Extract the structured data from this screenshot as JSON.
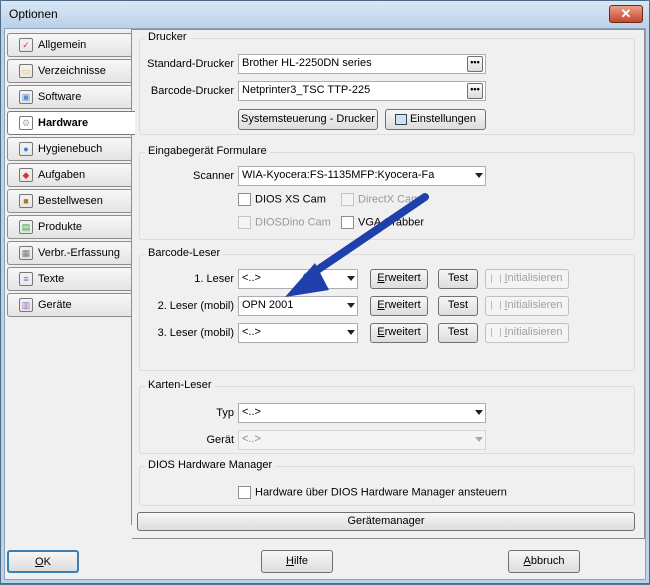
{
  "window": {
    "title": "Optionen",
    "close_glyph": "✕"
  },
  "tabs": [
    {
      "label": "Allgemein",
      "icon": "checklist-icon",
      "glyph": "✓",
      "color": "#d33"
    },
    {
      "label": "Verzeichnisse",
      "icon": "folder-icon",
      "glyph": "▭",
      "color": "#e8c04a"
    },
    {
      "label": "Software",
      "icon": "software-box-icon",
      "glyph": "▣",
      "color": "#5a8fd6"
    },
    {
      "label": "Hardware",
      "icon": "gear-icon",
      "glyph": "⚙",
      "color": "#aaa"
    },
    {
      "label": "Hygienebuch",
      "icon": "lightbulb-icon",
      "glyph": "●",
      "color": "#3a7fd0"
    },
    {
      "label": "Aufgaben",
      "icon": "tasks-icon",
      "glyph": "◆",
      "color": "#d33"
    },
    {
      "label": "Bestellwesen",
      "icon": "order-icon",
      "glyph": "■",
      "color": "#b07a1a"
    },
    {
      "label": "Produkte",
      "icon": "products-icon",
      "glyph": "▤",
      "color": "#2e9e3e"
    },
    {
      "label": "Verbr.-Erfassung",
      "icon": "capture-icon",
      "glyph": "▦",
      "color": "#777"
    },
    {
      "label": "Texte",
      "icon": "document-icon",
      "glyph": "≡",
      "color": "#4a7fc0"
    },
    {
      "label": "Geräte",
      "icon": "devices-icon",
      "glyph": "▥",
      "color": "#9a6cc0"
    }
  ],
  "drucker": {
    "title": "Drucker",
    "standard_label": "Standard-Drucker",
    "standard_value": "Brother HL-2250DN series",
    "barcode_label": "Barcode-Drucker",
    "barcode_value": "Netprinter3_TSC TTP-225",
    "browse_glyph": "•••",
    "systemsteuerung_button": "Systemsteuerung - Drucker",
    "einstellungen_button": "Einstellungen"
  },
  "eingabe": {
    "title": "Eingabegerät Formulare",
    "scanner_label": "Scanner",
    "scanner_value": "WIA-Kyocera:FS-1135MFP:Kyocera-Fa",
    "cb_dios_xs": "DIOS XS Cam",
    "cb_directx": "DirectX Cam",
    "cb_diosdino": "DIOSDino Cam",
    "cb_vga": "VGA Grabber"
  },
  "barcode_leser": {
    "title": "Barcode-Leser",
    "rows": [
      {
        "label": "1. Leser",
        "value": "<..>"
      },
      {
        "label": "2. Leser (mobil)",
        "value": "OPN 2001"
      },
      {
        "label": "3. Leser (mobil)",
        "value": "<..>"
      }
    ],
    "erweitert_first": "E",
    "erweitert_rest": "rweitert",
    "test": "Test",
    "initialisieren_first": "I",
    "initialisieren_rest": "nitialisieren"
  },
  "karten_leser": {
    "title": "Karten-Leser",
    "typ_label": "Typ",
    "typ_value": "<..>",
    "geraet_label": "Gerät",
    "geraet_value": "<..>"
  },
  "dios_manager": {
    "title": "DIOS Hardware Manager",
    "checkbox_label": "Hardware über DIOS Hardware Manager ansteuern"
  },
  "geraetemanager_button": "Gerätemanager",
  "footer": {
    "ok_first": "O",
    "ok_rest": "K",
    "hilfe_first": "H",
    "hilfe_rest": "ilfe",
    "abbruch_first": "A",
    "abbruch_rest": "bbruch"
  },
  "colors": {
    "annotation_arrow": "#1f3faa"
  }
}
